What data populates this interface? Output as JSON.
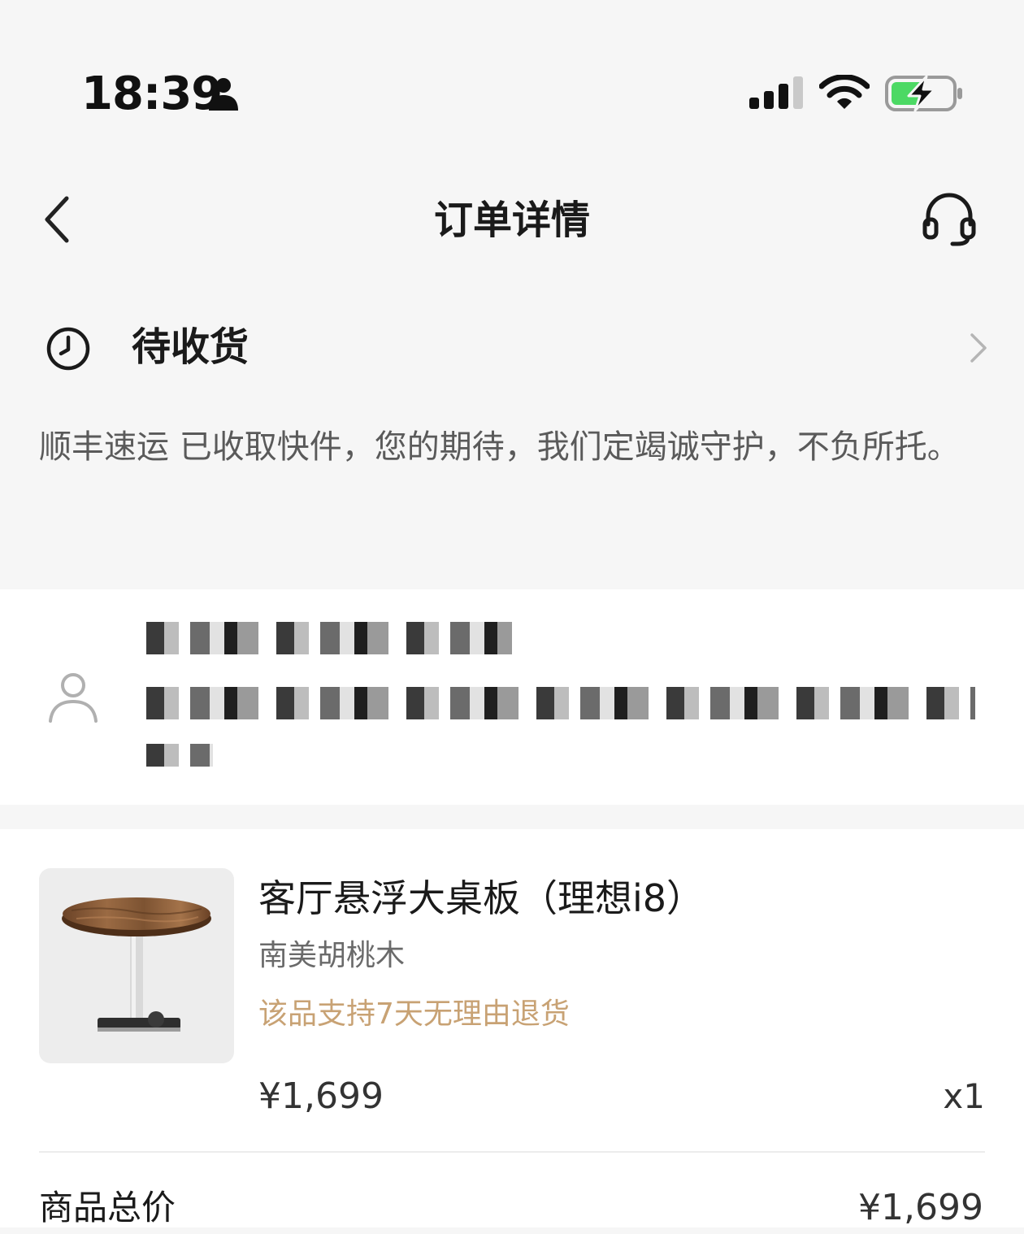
{
  "status_bar": {
    "time": "18:39",
    "icons": [
      "person-icon",
      "signal-icon",
      "wifi-icon",
      "battery-charging-icon"
    ],
    "battery_color": "#4cd964"
  },
  "nav": {
    "title": "订单详情",
    "back_icon": "chevron-left-icon",
    "support_icon": "headset-icon"
  },
  "order_status": {
    "label": "待收货",
    "icon": "clock-icon",
    "tracking_message": "顺丰速运 已收取快件，您的期待，我们定竭诚守护，不负所托。"
  },
  "address": {
    "icon": "user-icon"
  },
  "product": {
    "name": "客厅悬浮大桌板（理想i8）",
    "variant": "南美胡桃木",
    "return_policy": "该品支持7天无理由退货",
    "price": "¥1,699",
    "quantity": "x1",
    "accent_color": "#c8a274"
  },
  "summary": {
    "total_label": "商品总价",
    "total_value": "¥1,699"
  }
}
